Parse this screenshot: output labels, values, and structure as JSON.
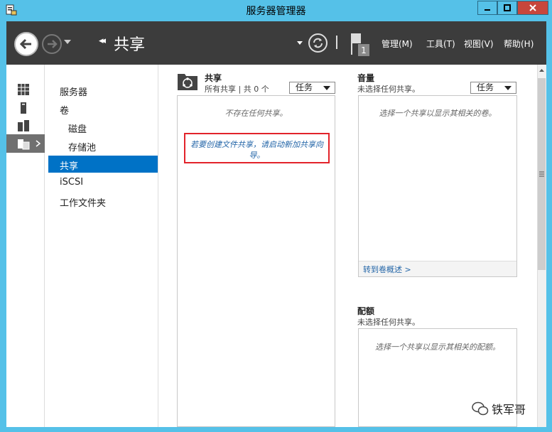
{
  "window": {
    "title": "服务器管理器"
  },
  "toolbar": {
    "breadcrumb_title": "共享",
    "breadcrumb_chevron": "◂◂",
    "flag_count": "1",
    "menus": [
      "管理(M)",
      "工具(T)",
      "视图(V)",
      "帮助(H)"
    ]
  },
  "tree": {
    "items": [
      "服务器",
      "卷",
      "磁盘",
      "存储池",
      "共享",
      "iSCSI",
      "工作文件夹"
    ],
    "selected": "共享"
  },
  "shares": {
    "title": "共享",
    "subtitle": "所有共享 | 共 0 个",
    "task_label": "任务",
    "empty_text": "不存在任何共享。",
    "wizard_link": "若要创建文件共享，请启动新加共享向导。"
  },
  "volume": {
    "title": "音量",
    "subtitle": "未选择任何共享。",
    "task_label": "任务",
    "empty_text": "选择一个共享以显示其相关的卷。",
    "footer_link": "转到卷概述 >"
  },
  "quota": {
    "title": "配额",
    "subtitle": "未选择任何共享。",
    "empty_text": "选择一个共享以显示其相关的配额。"
  },
  "watermark": {
    "text": "铁军哥"
  },
  "colors": {
    "titlebar": "#55c1e8",
    "toolbar": "#3c3c3c",
    "selection": "#0072c6",
    "close": "#c7463c",
    "highlight_border": "#e2232a"
  }
}
